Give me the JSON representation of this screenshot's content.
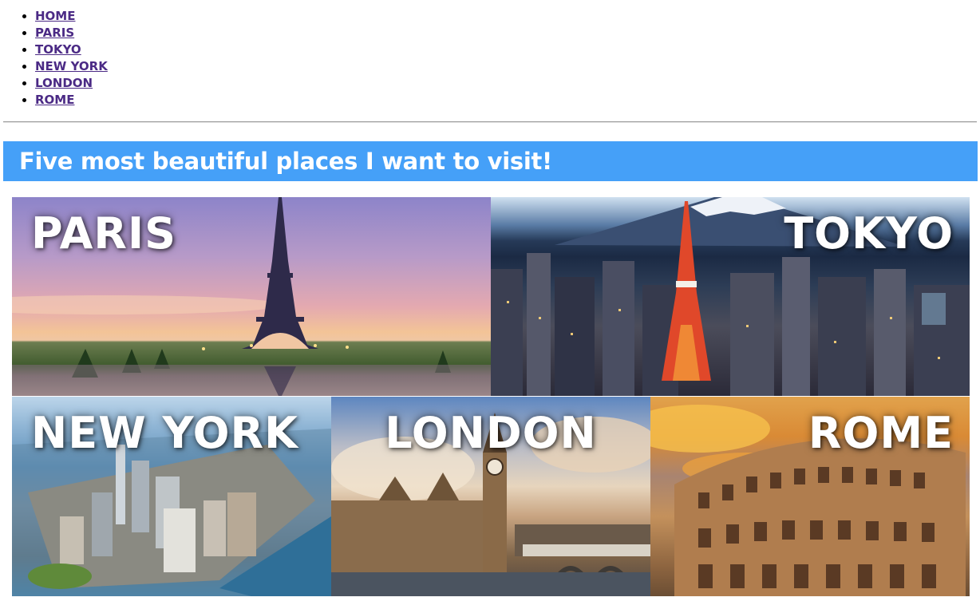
{
  "nav": {
    "items": [
      {
        "label": "HOME"
      },
      {
        "label": "PARIS"
      },
      {
        "label": "TOKYO"
      },
      {
        "label": "NEW YORK"
      },
      {
        "label": "LONDON"
      },
      {
        "label": "ROME"
      }
    ]
  },
  "banner": {
    "title": "Five most beautiful places I want to visit!"
  },
  "gallery": {
    "tiles": [
      {
        "label": "PARIS",
        "align": "left"
      },
      {
        "label": "TOKYO",
        "align": "right"
      },
      {
        "label": "NEW YORK",
        "align": "left"
      },
      {
        "label": "LONDON",
        "align": "center"
      },
      {
        "label": "ROME",
        "align": "right"
      }
    ]
  },
  "colors": {
    "banner_bg": "#45a0f8",
    "banner_text": "#ffffff",
    "link": "#4b2a85"
  }
}
